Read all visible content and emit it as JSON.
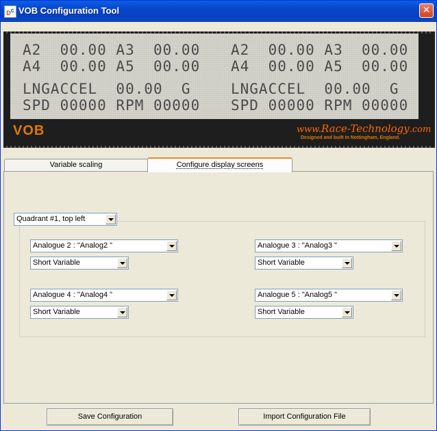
{
  "window": {
    "title": "VOB Configuration Tool",
    "icon_text": "D",
    "icon_sup": "C",
    "close_glyph": "✕"
  },
  "lcd": {
    "lines": [
      "A2  00.00 A3  00.00",
      "A4  00.00 A5  00.00",
      "LNGACCEL  00.00  G",
      "SPD 00000 RPM 00000"
    ],
    "lines_right": [
      "A2  00.00 A3  00.00",
      "A4  00.00 A5  00.00",
      "LNGACCEL  00.00  G",
      "SPD 00000 RPM 00000"
    ],
    "brand": "VOB",
    "url_prefix": "www.",
    "url_main": "Race-Technology",
    "url_suffix": ".com",
    "tagline": "Designed and built in Nottingham, England."
  },
  "tabs": [
    {
      "label": "Variable scaling",
      "active": false
    },
    {
      "label": "Configure display screens",
      "active": true
    }
  ],
  "quadrant": {
    "selected": "Quadrant #1, top left"
  },
  "slots": [
    {
      "channel": "Analogue 2 : \"Analog2 \"",
      "format": "Short Variable"
    },
    {
      "channel": "Analogue 3 : \"Analog3 \"",
      "format": "Short Variable"
    },
    {
      "channel": "Analogue 4 : \"Analog4 \"",
      "format": "Short Variable"
    },
    {
      "channel": "Analogue 5 : \"Analog5 \"",
      "format": "Short Variable"
    }
  ],
  "buttons": {
    "save": "Save Configuration",
    "import": "Import Configuration File"
  },
  "colors": {
    "titlebar": "#0746c9",
    "lcd_bg": "#d4d4cc",
    "lcd_text": "#4a4a4a",
    "brand_orange": "#e07a00",
    "active_tab_accent": "#e68b2c"
  }
}
